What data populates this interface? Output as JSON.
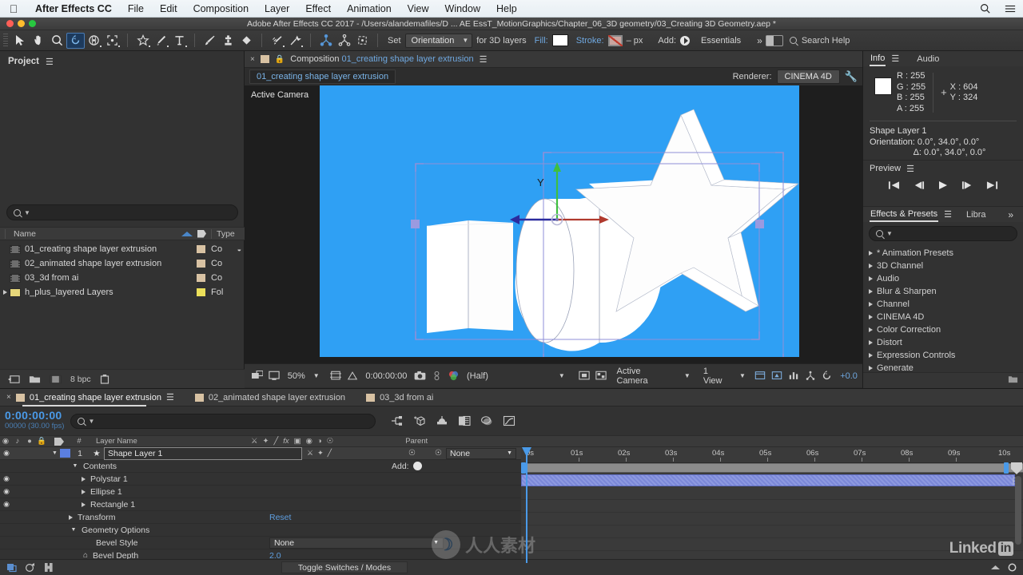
{
  "menubar": {
    "apple": "apple-logo",
    "items": [
      "After Effects CC",
      "File",
      "Edit",
      "Composition",
      "Layer",
      "Effect",
      "Animation",
      "View",
      "Window",
      "Help"
    ]
  },
  "titlebar": {
    "text": "Adobe After Effects CC 2017 - /Users/alandemafiles/D ... AE EssT_MotionGraphics/Chapter_06_3D geometry/03_Creating 3D Geometry.aep *"
  },
  "toolbar": {
    "set_label": "Set",
    "orientation_value": "Orientation",
    "for_3d_label": "for 3D layers",
    "fill_label": "Fill:",
    "fill_color": "#ffffff",
    "stroke_label": "Stroke:",
    "stroke_width": "– px",
    "add_label": "Add:",
    "workspace": "Essentials",
    "overflow": "»",
    "search_help": "Search Help"
  },
  "project": {
    "title": "Project",
    "search_placeholder": "",
    "columns": {
      "name": "Name",
      "type": "Type"
    },
    "items": [
      {
        "name": "01_creating shape layer extrusion",
        "type": "Co",
        "kind": "comp",
        "has_children": true
      },
      {
        "name": "02_animated shape layer extrusion",
        "type": "Co",
        "kind": "comp",
        "has_children": false
      },
      {
        "name": "03_3d from ai",
        "type": "Co",
        "kind": "comp",
        "has_children": false
      },
      {
        "name": "h_plus_layered Layers",
        "type": "Fol",
        "kind": "folder",
        "has_children": false
      }
    ],
    "footer": {
      "bpc": "8 bpc"
    }
  },
  "composition": {
    "tab_prefix": "Composition",
    "tab_name": "01_creating shape layer extrusion",
    "name_field": "01_creating shape layer extrusion",
    "renderer_label": "Renderer:",
    "renderer_value": "CINEMA 4D",
    "view_label": "Active Camera",
    "background_color": "#2fa0f4",
    "footer": {
      "zoom": "50%",
      "timecode": "0:00:00:00",
      "resolution": "(Half)",
      "camera": "Active Camera",
      "views": "1 View",
      "exposure": "+0.0"
    }
  },
  "info": {
    "tabs": [
      "Info",
      "Audio"
    ],
    "active_tab": "Info",
    "r": "R : 255",
    "g": "G : 255",
    "b": "B : 255",
    "a": "A : 255",
    "x": "X : 604",
    "y": "Y : 324",
    "layer": "Shape Layer 1",
    "orientation": "Orientation: 0.0°, 34.0°, 0.0°",
    "delta": "Δ: 0.0°, 34.0°, 0.0°",
    "swatch": "#ffffff"
  },
  "preview": {
    "title": "Preview"
  },
  "effects": {
    "tabs": [
      "Effects & Presets",
      "Libra"
    ],
    "active_tab": "Effects & Presets",
    "overflow": "»",
    "categories": [
      "* Animation Presets",
      "3D Channel",
      "Audio",
      "Blur & Sharpen",
      "Channel",
      "CINEMA 4D",
      "Color Correction",
      "Distort",
      "Expression Controls",
      "Generate"
    ]
  },
  "timeline": {
    "tabs": [
      {
        "label": "01_creating shape layer extrusion",
        "active": true
      },
      {
        "label": "02_animated shape layer extrusion",
        "active": false
      },
      {
        "label": "03_3d from ai",
        "active": false
      }
    ],
    "current_time": "0:00:00:00",
    "frame_info": "00000 (30.00 fps)",
    "search_placeholder": "",
    "columns": {
      "num": "#",
      "layer_name": "Layer Name",
      "parent": "Parent"
    },
    "rows": [
      {
        "indent": 0,
        "label": "Shape Layer 1",
        "number": "1",
        "kind": "layer",
        "expanded": true,
        "eye": true,
        "parent": "None"
      },
      {
        "indent": 1,
        "label": "Contents",
        "kind": "group",
        "expanded": true,
        "add_label": "Add:"
      },
      {
        "indent": 2,
        "label": "Polystar 1",
        "kind": "shape",
        "expanded": false,
        "eye": true
      },
      {
        "indent": 2,
        "label": "Ellipse 1",
        "kind": "shape",
        "expanded": false,
        "eye": true
      },
      {
        "indent": 2,
        "label": "Rectangle 1",
        "kind": "shape",
        "expanded": false,
        "eye": true
      },
      {
        "indent": 1,
        "label": "Transform",
        "kind": "group",
        "expanded": false,
        "value": "Reset"
      },
      {
        "indent": 1,
        "label": "Geometry Options",
        "kind": "group",
        "expanded": true
      },
      {
        "indent": 2,
        "label": "Bevel Style",
        "kind": "prop",
        "value": "None"
      },
      {
        "indent": 2,
        "label": "Bevel Depth",
        "kind": "prop",
        "value": "2.0"
      }
    ],
    "ruler_ticks": [
      "0s",
      "01s",
      "02s",
      "03s",
      "04s",
      "05s",
      "06s",
      "07s",
      "08s",
      "09s",
      "10s"
    ],
    "footer": {
      "toggle": "Toggle Switches / Modes"
    }
  },
  "watermarks": {
    "linkedin": "Linked",
    "linkedin_badge": "in",
    "cn": "人人素材"
  },
  "colors": {
    "accent_blue": "#4a9ae8",
    "panel_bg": "#323232",
    "canvas": "#2fa0f4"
  }
}
